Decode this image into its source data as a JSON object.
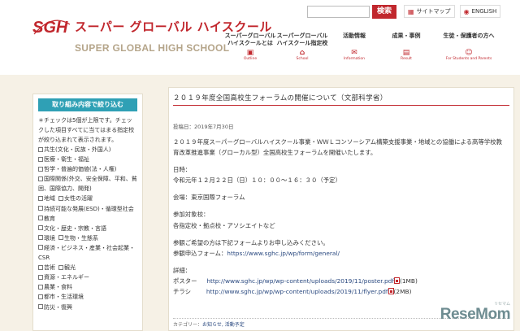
{
  "header": {
    "logo_mark": "SGH",
    "logo_jp": "スーパー グローバル ハイスクール",
    "logo_en": "SUPER GLOBAL HIGH SCHOOL",
    "search_button": "検索",
    "links": [
      {
        "label": "サイトマップ",
        "icon": "sitemap-icon"
      },
      {
        "label": "ENGLISH",
        "icon": "globe-icon"
      }
    ],
    "nav": [
      {
        "line1": "スーパーグローバル",
        "line2": "ハイスクールとは",
        "en": "Outline"
      },
      {
        "line1": "スーパーグローバル",
        "line2": "ハイスクール指定校",
        "en": "School"
      },
      {
        "line1": "活動情報",
        "line2": "",
        "en": "Information"
      },
      {
        "line1": "成果・事例",
        "line2": "",
        "en": "Result"
      },
      {
        "line1": "生徒・保護者の方へ",
        "line2": "",
        "en": "For Students and Parents"
      }
    ]
  },
  "sidebar": {
    "title": "取り組み内容で絞り込む",
    "note": "＊チェックは5個が上限です。チェックした項目すべてに当てはまる指定校が絞り込まれて表示されます。",
    "items": [
      "共生(文化・民族・外国人)",
      "医療・衛生・福祉",
      "哲学・普遍的価値(法・人権)",
      "国際関係(外交、安全保障、平和、貧困、国際協力、開発)",
      "地域",
      "女性の活躍",
      "持続可能な発展(ESD)・循環型社会",
      "教育",
      "文化・歴史・宗教・言語",
      "環境",
      "生物・生態系",
      "経済・ビジネス・産業・社会起業・CSR",
      "芸術",
      "観光",
      "資源・エネルギー",
      "農業・食料",
      "都市・生活環境",
      "防災・復興"
    ]
  },
  "article": {
    "title": "２０１９年度全国高校生フォーラムの開催について（文部科学省）",
    "date": "投稿日：2019年7月30日",
    "intro": "２０１９年度スーパーグローバルハイスクール事業・ＷＷＬコンソーシアム構築支援事業・地域との協働による高等学校教育改革推進事業（グローカル型）全国高校生フォーラムを開催いたします。",
    "datetime_label": "日時：",
    "datetime_value": "令和元年１２月２２日（日）１０：００～１６：３０（予定）",
    "venue": "会場：東京国際フォーラム",
    "target_label": "参加対象校：",
    "target_value": "各指定校・拠点校・アソシエイトなど",
    "apply_note": "参観ご希望の方は下記フォームよりお申し込みください。",
    "apply_label": "参観申込フォーム：",
    "apply_url": "https://www.sghc.jp/wp/form/general/",
    "details_label": "詳細：",
    "poster_label": "ポスター",
    "poster_url": "http://www.sghc.jp/wp/wp-content/uploads/2019/11/poster.pdf",
    "poster_size": "(1MB)",
    "flyer_label": "チラシ",
    "flyer_url": "http://www.sghc.jp/wp/wp-content/uploads/2019/11/flyer.pdf",
    "flyer_size": "(2MB)",
    "category_label": "カテゴリー：",
    "category_values": "お知らせ, 活動予定"
  },
  "watermark": {
    "small": "リセマム",
    "text": "ReseMom"
  },
  "colors": {
    "brand_red": "#c1272d",
    "teal": "#2fa0b5",
    "beige": "#f6f1e6"
  }
}
